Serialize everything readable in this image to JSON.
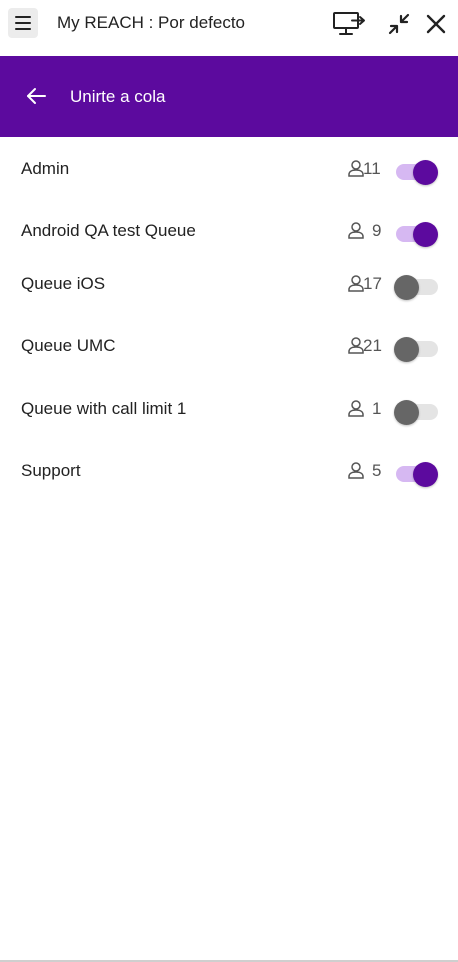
{
  "titlebar": {
    "title": "My REACH : Por defecto",
    "menu_icon": "hamburger-menu-icon",
    "screen_share_icon": "monitor-share-icon",
    "minimize_icon": "collapse-icon",
    "close_icon": "close-icon"
  },
  "header": {
    "title": "Unirte a cola",
    "back_icon": "arrow-left-icon",
    "color": "#5c0a9e"
  },
  "queues": [
    {
      "name": "Admin",
      "count": "11",
      "enabled": true
    },
    {
      "name": "Android QA test Queue",
      "count": "9",
      "enabled": true
    },
    {
      "name": "Queue iOS",
      "count": "17",
      "enabled": false
    },
    {
      "name": "Queue UMC",
      "count": "21",
      "enabled": false
    },
    {
      "name": "Queue with call limit 1",
      "count": "1",
      "enabled": false
    },
    {
      "name": "Support",
      "count": "5",
      "enabled": true
    }
  ],
  "colors": {
    "accent": "#5c0a9e",
    "toggle_track_on": "#d6b8f2",
    "toggle_knob_off": "#666666"
  }
}
